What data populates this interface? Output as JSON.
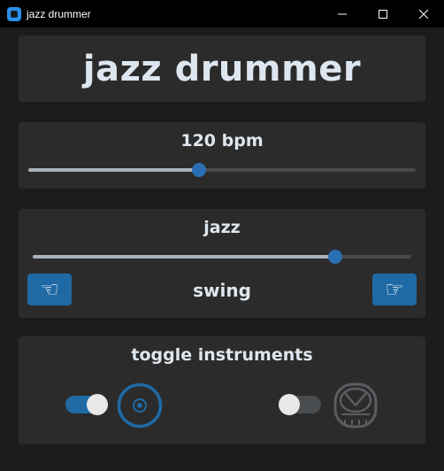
{
  "window": {
    "title": "jazz drummer",
    "controls": [
      "minimize-icon",
      "maximize-icon",
      "close-icon"
    ]
  },
  "app": {
    "title": "jazz drummer"
  },
  "tempo": {
    "label": "120 bpm",
    "slider_fraction": 0.44
  },
  "style": {
    "label": "jazz",
    "slider_fraction": 0.8,
    "feel_label": "swing",
    "prev_button_icon": "hand-pointing-left-icon",
    "next_button_icon": "hand-pointing-right-icon"
  },
  "instruments": {
    "label": "toggle instruments",
    "items": [
      {
        "icon": "cymbal-icon",
        "enabled": true
      },
      {
        "icon": "drum-icon",
        "enabled": false
      }
    ]
  },
  "colors": {
    "accent": "#1f6aa5",
    "background": "#1c1c1c",
    "card": "#2b2b2b",
    "text": "#dfe6ee"
  }
}
